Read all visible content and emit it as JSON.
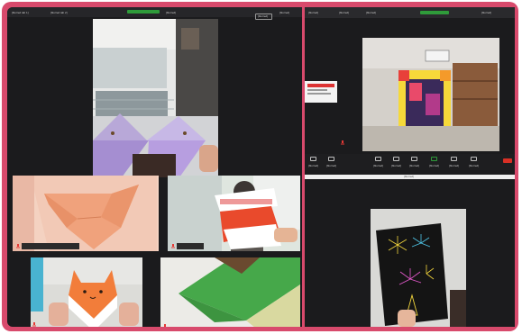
{
  "left_window": {
    "tabs": [
      "[blurred tab 1]",
      "[blurred tab 2]"
    ],
    "time_badge": "[blurred]",
    "right_info": "[blurred]",
    "view_button": "[blurred]"
  },
  "right_window": {
    "title": "[blurred]",
    "tabs": [
      "[blurred]",
      "[blurred]",
      "[blurred]"
    ],
    "toolbar_items": [
      "[blurred]",
      "[blurred]",
      "[blurred]",
      "[blurred]",
      "[blurred]",
      "[blurred]",
      "[blurred]",
      "[blurred]"
    ],
    "second_pane_title": "[blurred]"
  },
  "icons": [
    "mic-icon",
    "video-icon",
    "participants-icon",
    "chat-icon",
    "share-icon",
    "record-icon",
    "reactions-icon",
    "leave-icon"
  ],
  "colors": {
    "frame": "#d84a6c",
    "window_bg": "#1b1b1d",
    "accent_green": "#2f9b3a",
    "leave_red": "#d93025"
  }
}
